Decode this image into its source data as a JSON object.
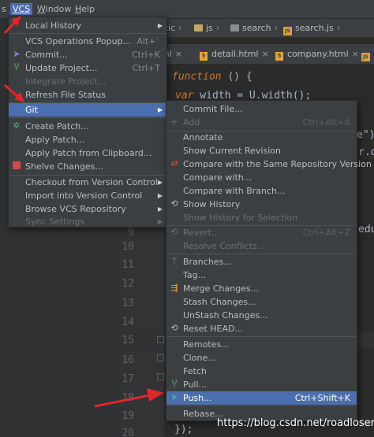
{
  "menubar": {
    "items": [
      {
        "mnemonic": "s",
        "rest": ""
      },
      {
        "mnemonic": "VCS",
        "rest": ""
      },
      {
        "mnemonic": "W",
        "rest": "indow"
      },
      {
        "mnemonic": "H",
        "rest": "elp"
      }
    ]
  },
  "navbar": {
    "crumbs": [
      "atic",
      "js",
      "search",
      "search.js"
    ]
  },
  "tabs": [
    {
      "label": "ml",
      "close": "×"
    },
    {
      "label": "detail.html",
      "close": "×"
    },
    {
      "label": "company.html",
      "close": "×"
    },
    {
      "label": "",
      "close": ""
    }
  ],
  "code": {
    "line1_kw": "function",
    "line1_rest": " () {",
    "line2_kw": "var",
    "line2_rest": " width = U.width();",
    "frag_a": "e\")",
    "frag_b": "r.ot",
    "frag_c": "edu",
    "frag_d": "});"
  },
  "gutter_numbers": [
    "9",
    "10",
    "11",
    "12",
    "13",
    "14",
    "15",
    "16",
    "17",
    "18",
    "19",
    "20"
  ],
  "vcs_menu": {
    "items": [
      {
        "label": "Local History",
        "has_submenu": true,
        "icon": ""
      },
      {
        "label": "VCS Operations Popup...",
        "shortcut": "Alt+`",
        "icon": ""
      },
      {
        "label": "Commit...",
        "shortcut": "Ctrl+K",
        "icon": "commit-icon"
      },
      {
        "label": "Update Project...",
        "shortcut": "Ctrl+T",
        "icon": "update-icon"
      },
      {
        "label": "Integrate Project...",
        "disabled": true,
        "icon": ""
      },
      {
        "label": "Refresh File Status",
        "icon": ""
      },
      {
        "label": "Git",
        "has_submenu": true,
        "selected": true,
        "icon": ""
      },
      {
        "label": "Create Patch...",
        "icon": "create-patch-icon"
      },
      {
        "label": "Apply Patch...",
        "icon": ""
      },
      {
        "label": "Apply Patch from Clipboard...",
        "icon": ""
      },
      {
        "label": "Shelve Changes...",
        "icon": "shelve-icon"
      },
      {
        "label": "Checkout from Version Control",
        "has_submenu": true,
        "icon": ""
      },
      {
        "label": "Import into Version Control",
        "has_submenu": true,
        "icon": ""
      },
      {
        "label": "Browse VCS Repository",
        "has_submenu": true,
        "icon": ""
      },
      {
        "label": "Sync Settings",
        "has_submenu": true,
        "disabled": true,
        "icon": ""
      }
    ]
  },
  "git_menu": {
    "items": [
      {
        "label": "Commit File...",
        "icon": ""
      },
      {
        "label": "Add",
        "shortcut": "Ctrl+Alt+A",
        "disabled": true,
        "icon": "add-icon"
      },
      {
        "label": "Annotate",
        "icon": ""
      },
      {
        "label": "Show Current Revision",
        "icon": ""
      },
      {
        "label": "Compare with the Same Repository Version",
        "icon": "compare-icon"
      },
      {
        "label": "Compare with...",
        "icon": ""
      },
      {
        "label": "Compare with Branch...",
        "icon": ""
      },
      {
        "label": "Show History",
        "icon": "history-icon"
      },
      {
        "label": "Show History for Selection",
        "disabled": true,
        "icon": ""
      },
      {
        "label": "Revert...",
        "shortcut": "Ctrl+Alt+Z",
        "disabled": true,
        "icon": "revert-icon"
      },
      {
        "label": "Resolve Conflicts...",
        "disabled": true,
        "icon": ""
      },
      {
        "label": "Branches...",
        "icon": "branches-icon"
      },
      {
        "label": "Tag...",
        "icon": ""
      },
      {
        "label": "Merge Changes...",
        "icon": "merge-icon"
      },
      {
        "label": "Stash Changes...",
        "icon": ""
      },
      {
        "label": "UnStash Changes...",
        "icon": ""
      },
      {
        "label": "Reset HEAD...",
        "icon": "reset-icon"
      },
      {
        "label": "Remotes...",
        "icon": ""
      },
      {
        "label": "Clone...",
        "icon": ""
      },
      {
        "label": "Fetch",
        "icon": ""
      },
      {
        "label": "Pull...",
        "icon": "pull-icon"
      },
      {
        "label": "Push...",
        "shortcut": "Ctrl+Shift+K",
        "selected": true,
        "icon": "push-icon"
      },
      {
        "label": "Rebase...",
        "icon": ""
      }
    ]
  },
  "watermark": "https://blog.csdn.net/roadloser",
  "colors": {
    "selection": "#4b6eaf",
    "menu_bg": "#3c3f41",
    "annotation_arrow": "#e0262b"
  }
}
